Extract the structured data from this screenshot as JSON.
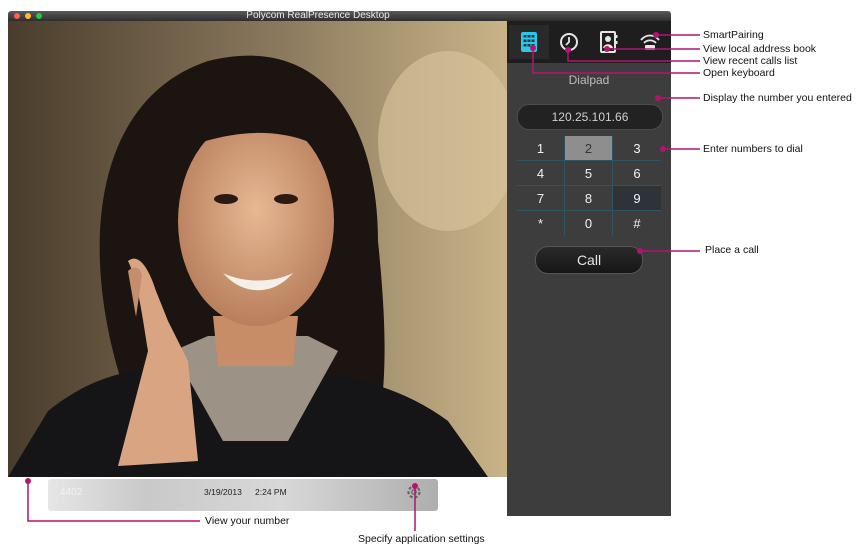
{
  "window": {
    "title": "Polycom RealPresence Desktop"
  },
  "panel": {
    "tabs": [
      {
        "name": "dialpad-icon",
        "active": true
      },
      {
        "name": "clock-icon",
        "active": false
      },
      {
        "name": "address-book-icon",
        "active": false
      },
      {
        "name": "wifi-pairing-icon",
        "active": false
      }
    ],
    "pane_title": "Dialpad",
    "number_entered": "120.25.101.66",
    "keys": [
      "1",
      "2",
      "3",
      "4",
      "5",
      "6",
      "7",
      "8",
      "9",
      "*",
      "0",
      "#"
    ],
    "pressed_key": "2",
    "highlighted_key": "9",
    "call_label": "Call"
  },
  "statusbar": {
    "own_number": "4402",
    "date": "3/19/2013",
    "time": "2:24 PM",
    "settings_icon": "gear-icon"
  },
  "callouts": {
    "smart_pairing": "SmartPairing",
    "address_book": "View local address book",
    "recent_calls": "View recent calls list",
    "open_keyboard": "Open keyboard",
    "display_number": "Display the number you entered",
    "enter_numbers": "Enter numbers to dial",
    "place_call": "Place a call",
    "view_number": "View your number",
    "app_settings": "Specify application settings"
  },
  "colors": {
    "accent": "#b3146e",
    "active_tab": "#2ec7e8"
  }
}
